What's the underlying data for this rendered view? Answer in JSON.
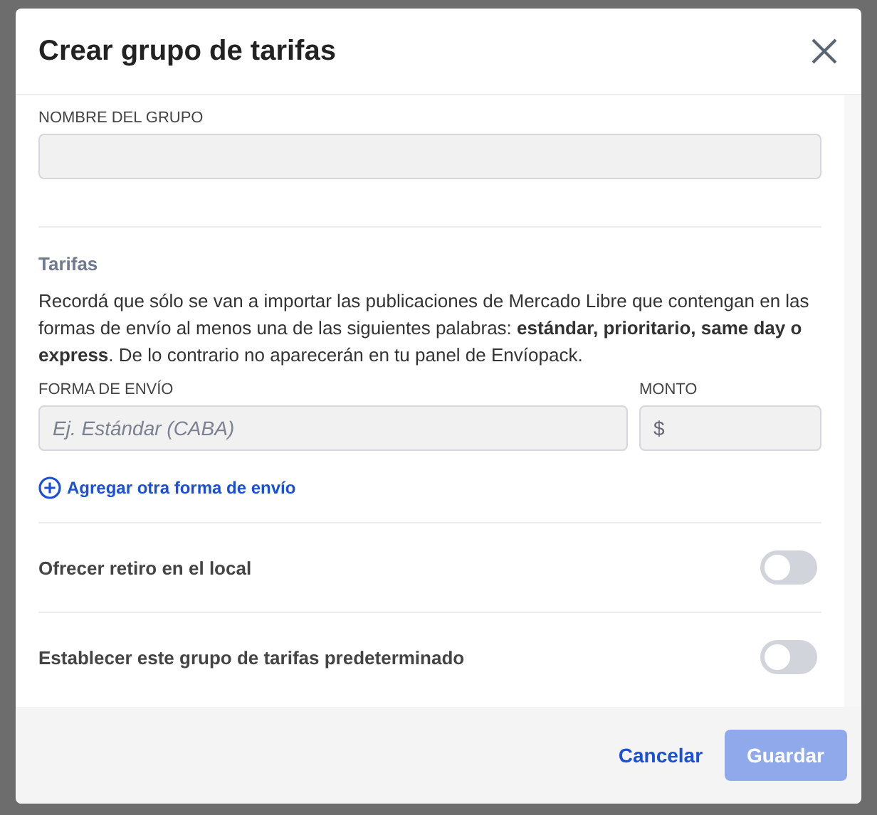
{
  "dialog": {
    "title": "Crear grupo de tarifas"
  },
  "group_name": {
    "label": "NOMBRE DEL GRUPO"
  },
  "rates": {
    "heading": "Tarifas",
    "notice": "Recordá que sólo se van a importar las publicaciones de Mercado Libre que contengan en las formas de envío al menos una de las siguientes palabras: **estándar, prioritario, same day o express**. De lo contrario no aparecerán en tu panel de Envíopack.",
    "method_label": "FORMA DE ENVÍO",
    "method_placeholder": "Ej. Estándar (CABA)",
    "amount_label": "MONTO",
    "currency": "$",
    "add_link": "Agregar otra forma de envío"
  },
  "switches": [
    {
      "label": "Ofrecer retiro en el local",
      "on": false
    },
    {
      "label": "Establecer este grupo de tarifas predeterminado",
      "on": false
    }
  ],
  "footer": {
    "cancel": "Cancelar",
    "save": {
      "label": "Guardar",
      "disabled": true
    }
  }
}
